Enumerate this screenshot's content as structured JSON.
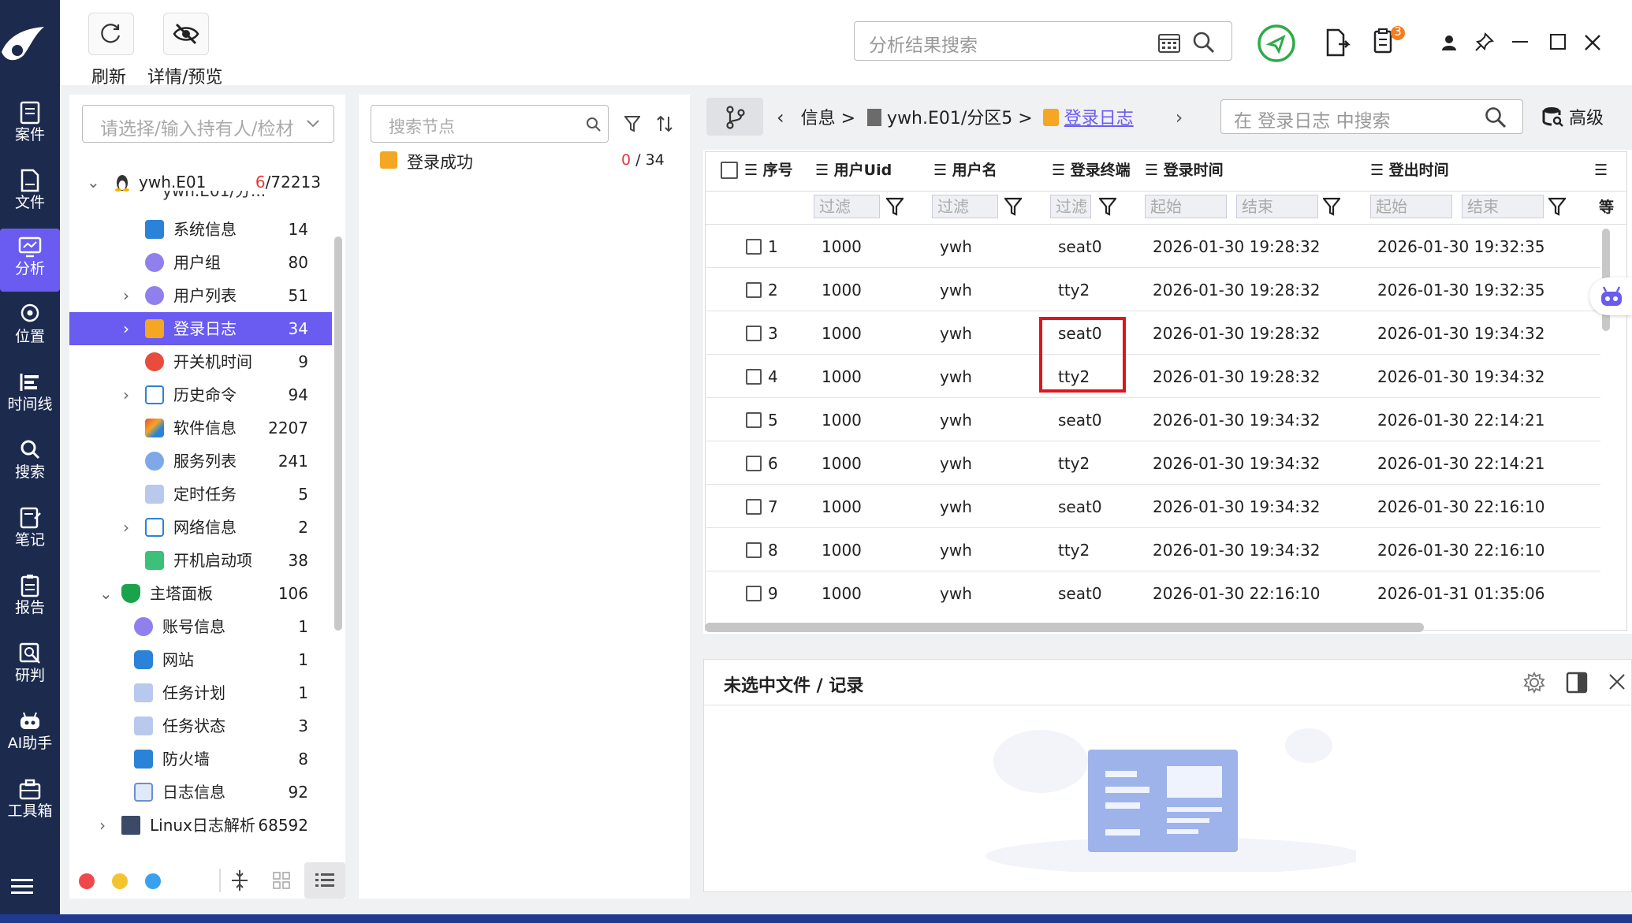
{
  "sidebar": {
    "logo": "app-logo",
    "items": [
      {
        "label": "案件",
        "icon": "case-icon"
      },
      {
        "label": "文件",
        "icon": "file-icon"
      },
      {
        "label": "分析",
        "icon": "analysis-icon",
        "active": true
      },
      {
        "label": "位置",
        "icon": "location-icon"
      },
      {
        "label": "时间线",
        "icon": "timeline-icon"
      },
      {
        "label": "搜索",
        "icon": "search-icon"
      },
      {
        "label": "笔记",
        "icon": "note-icon"
      },
      {
        "label": "报告",
        "icon": "report-icon"
      },
      {
        "label": "研判",
        "icon": "judge-icon"
      },
      {
        "label": "AI助手",
        "icon": "ai-assistant-icon"
      },
      {
        "label": "工具箱",
        "icon": "toolbox-icon"
      }
    ]
  },
  "toolbar": {
    "refresh_label": "刷新",
    "preview_label": "详情/预览",
    "search_placeholder": "分析结果搜索",
    "notification_count": "3"
  },
  "tree": {
    "owner_placeholder": "请选择/输入持有人/检材",
    "root": {
      "label": "ywh.E01",
      "count_red": "6",
      "count_total": "/72213"
    },
    "partial_label": "ywh.E01/分...",
    "items": [
      {
        "label": "系统信息",
        "count": "14"
      },
      {
        "label": "用户组",
        "count": "80"
      },
      {
        "label": "用户列表",
        "count": "51"
      },
      {
        "label": "登录日志",
        "count": "34"
      },
      {
        "label": "开关机时间",
        "count": "9"
      },
      {
        "label": "历史命令",
        "count": "94"
      },
      {
        "label": "软件信息",
        "count": "2207"
      },
      {
        "label": "服务列表",
        "count": "241"
      },
      {
        "label": "定时任务",
        "count": "5"
      },
      {
        "label": "网络信息",
        "count": "2"
      },
      {
        "label": "开机启动项",
        "count": "38"
      },
      {
        "label": "主塔面板",
        "count": "106"
      },
      {
        "label": "账号信息",
        "count": "1"
      },
      {
        "label": "网站",
        "count": "1"
      },
      {
        "label": "任务计划",
        "count": "1"
      },
      {
        "label": "任务状态",
        "count": "3"
      },
      {
        "label": "防火墙",
        "count": "8"
      },
      {
        "label": "日志信息",
        "count": "92"
      },
      {
        "label": "Linux日志解析",
        "count": "68592"
      }
    ],
    "dot_colors": [
      "#f04848",
      "#f4c430",
      "#3aa0f0"
    ]
  },
  "nodes": {
    "search_placeholder": "搜索节点",
    "items": [
      {
        "label": "登录成功",
        "count_red": "0",
        "count_total": " / 34"
      }
    ]
  },
  "breadcrumb": {
    "part1": "信息 >",
    "part2": "ywh.E01/分区5 >",
    "current": "登录日志",
    "search_placeholder": "在 登录日志 中搜索",
    "advanced_label": "高级"
  },
  "table": {
    "headers": [
      "序号",
      "用户Uid",
      "用户名",
      "登录终端",
      "登录时间",
      "登出时间",
      "等"
    ],
    "filter_placeholder": "过滤",
    "start_placeholder": "起始",
    "end_placeholder": "结束",
    "rows": [
      {
        "id": "1",
        "uid": "1000",
        "user": "ywh",
        "tty": "seat0",
        "login": "2026-01-30 19:28:32",
        "logout": "2026-01-30 19:32:35"
      },
      {
        "id": "2",
        "uid": "1000",
        "user": "ywh",
        "tty": "tty2",
        "login": "2026-01-30 19:28:32",
        "logout": "2026-01-30 19:32:35"
      },
      {
        "id": "3",
        "uid": "1000",
        "user": "ywh",
        "tty": "seat0",
        "login": "2026-01-30 19:28:32",
        "logout": "2026-01-30 19:34:32"
      },
      {
        "id": "4",
        "uid": "1000",
        "user": "ywh",
        "tty": "tty2",
        "login": "2026-01-30 19:28:32",
        "logout": "2026-01-30 19:34:32"
      },
      {
        "id": "5",
        "uid": "1000",
        "user": "ywh",
        "tty": "seat0",
        "login": "2026-01-30 19:34:32",
        "logout": "2026-01-30 22:14:21"
      },
      {
        "id": "6",
        "uid": "1000",
        "user": "ywh",
        "tty": "tty2",
        "login": "2026-01-30 19:34:32",
        "logout": "2026-01-30 22:14:21"
      },
      {
        "id": "7",
        "uid": "1000",
        "user": "ywh",
        "tty": "seat0",
        "login": "2026-01-30 19:34:32",
        "logout": "2026-01-30 22:16:10"
      },
      {
        "id": "8",
        "uid": "1000",
        "user": "ywh",
        "tty": "tty2",
        "login": "2026-01-30 19:34:32",
        "logout": "2026-01-30 22:16:10"
      },
      {
        "id": "9",
        "uid": "1000",
        "user": "ywh",
        "tty": "seat0",
        "login": "2026-01-30 22:16:10",
        "logout": "2026-01-31 01:35:06"
      }
    ]
  },
  "detail": {
    "title": "未选中文件 / 记录"
  }
}
